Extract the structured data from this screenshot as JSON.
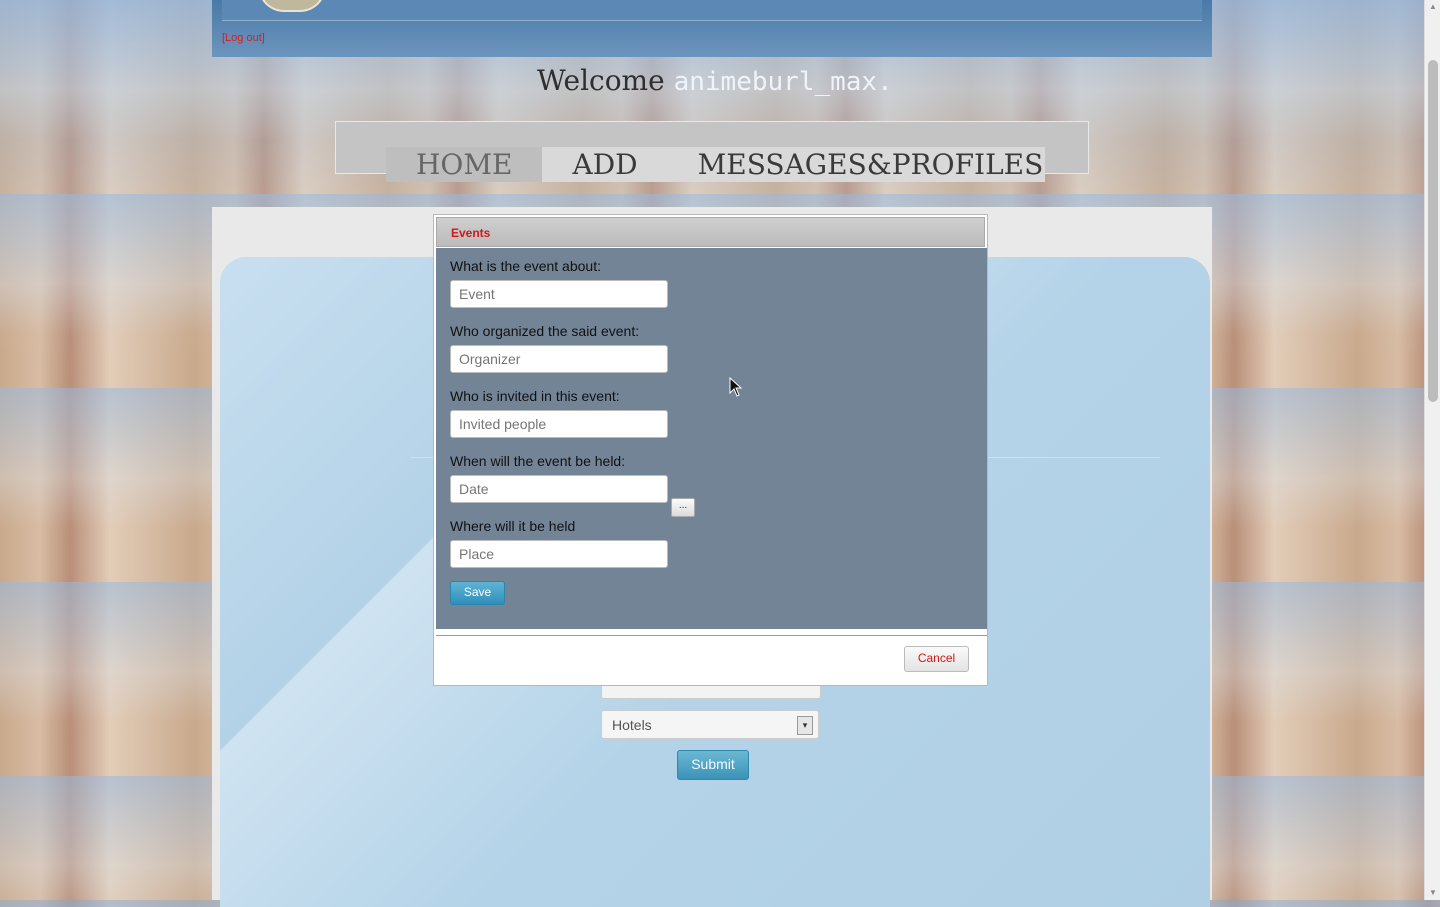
{
  "header": {
    "logout_label": "[Log out]"
  },
  "welcome": {
    "prefix": "Welcome",
    "username": "animeburl_max."
  },
  "nav": {
    "items": [
      {
        "label": "HOME"
      },
      {
        "label": "ADD"
      },
      {
        "label": "MESSAGES&PROFILES"
      }
    ]
  },
  "background_form": {
    "select_value": "Hotels",
    "select_arrow": "▾",
    "submit_label": "Submit"
  },
  "modal": {
    "title": "Events",
    "fields": [
      {
        "label": "What is the event about:",
        "placeholder": "Event"
      },
      {
        "label": "Who organized the said event:",
        "placeholder": "Organizer"
      },
      {
        "label": "Who is invited in this event:",
        "placeholder": "Invited people"
      },
      {
        "label": "When will the event be held:",
        "placeholder": "Date"
      },
      {
        "label": "Where will it be held",
        "placeholder": "Place"
      }
    ],
    "date_picker_label": "...",
    "save_label": "Save",
    "cancel_label": "Cancel"
  },
  "colors": {
    "accent_red": "#d01818",
    "modal_body": "#738497",
    "button_blue": "#2f8fba"
  }
}
